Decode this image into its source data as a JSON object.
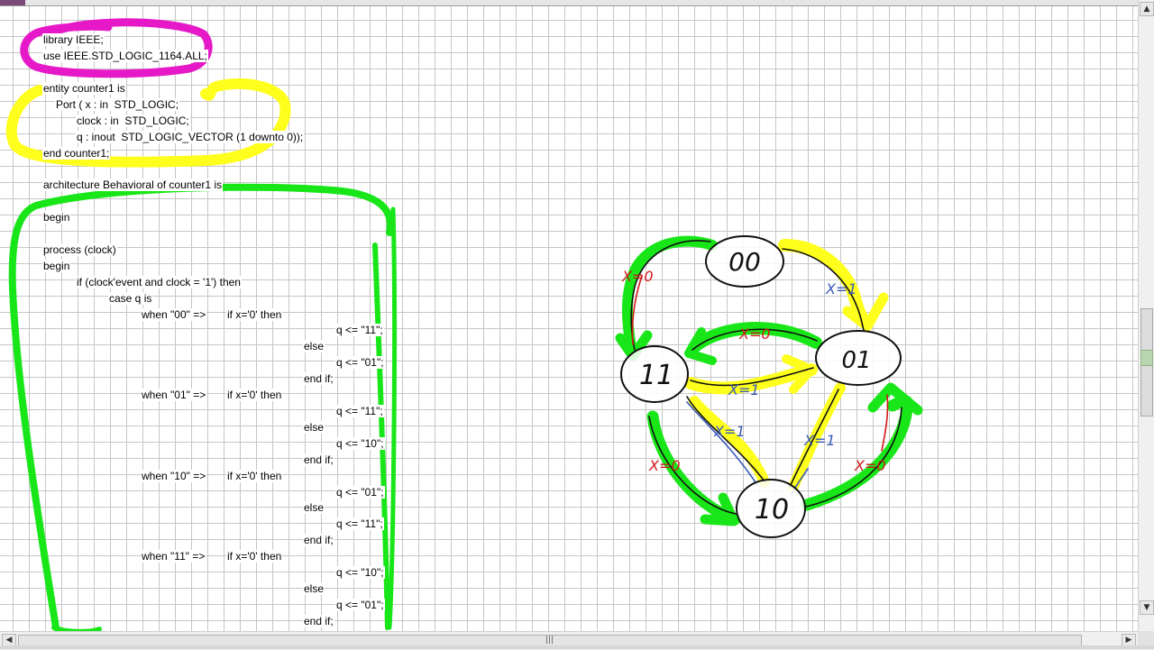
{
  "code": [
    "library IEEE;",
    "use IEEE.STD_LOGIC_1164.ALL;",
    "entity counter1 is",
    "Port ( x : in  STD_LOGIC;",
    "clock : in  STD_LOGIC;",
    "q : inout  STD_LOGIC_VECTOR (1 downto 0));",
    "end counter1;",
    "architecture Behavioral of counter1 is",
    "begin",
    "process (clock)",
    "begin",
    "if (clock'event and clock = '1') then",
    "case q is",
    "when \"00\" =>",
    "if x='0' then",
    "q <= \"11\";",
    "else",
    "q <= \"01\";",
    "end if;",
    "when \"01\" =>",
    "if x='0' then",
    "q <= \"11\";",
    "else",
    "q <= \"10\";",
    "end if;",
    "when \"10\" =>",
    "if x='0' then",
    "q <= \"01\";",
    "else",
    "q <= \"11\";",
    "end if;",
    "when \"11\" =>",
    "if x='0' then",
    "q <= \"10\";",
    "else",
    "q <= \"01\";",
    "end if;"
  ],
  "diagram": {
    "states": [
      "00",
      "01",
      "10",
      "11"
    ],
    "transition_labels": [
      "X=0",
      "X=1",
      "X=0",
      "X=1",
      "X=0",
      "X=1",
      "X=1",
      "X=0"
    ]
  },
  "colors": {
    "highlight_magenta": "#e619c8",
    "highlight_yellow": "#ffff1e",
    "highlight_green": "#19e619",
    "pen_red": "#d01818",
    "pen_blue": "#3a5ab8",
    "grid": "#c6c6c6"
  },
  "scrollbar": {
    "up_icon": "▲",
    "down_icon": "▼",
    "left_icon": "◀",
    "right_icon": "▶",
    "grip_icon": "|||"
  }
}
